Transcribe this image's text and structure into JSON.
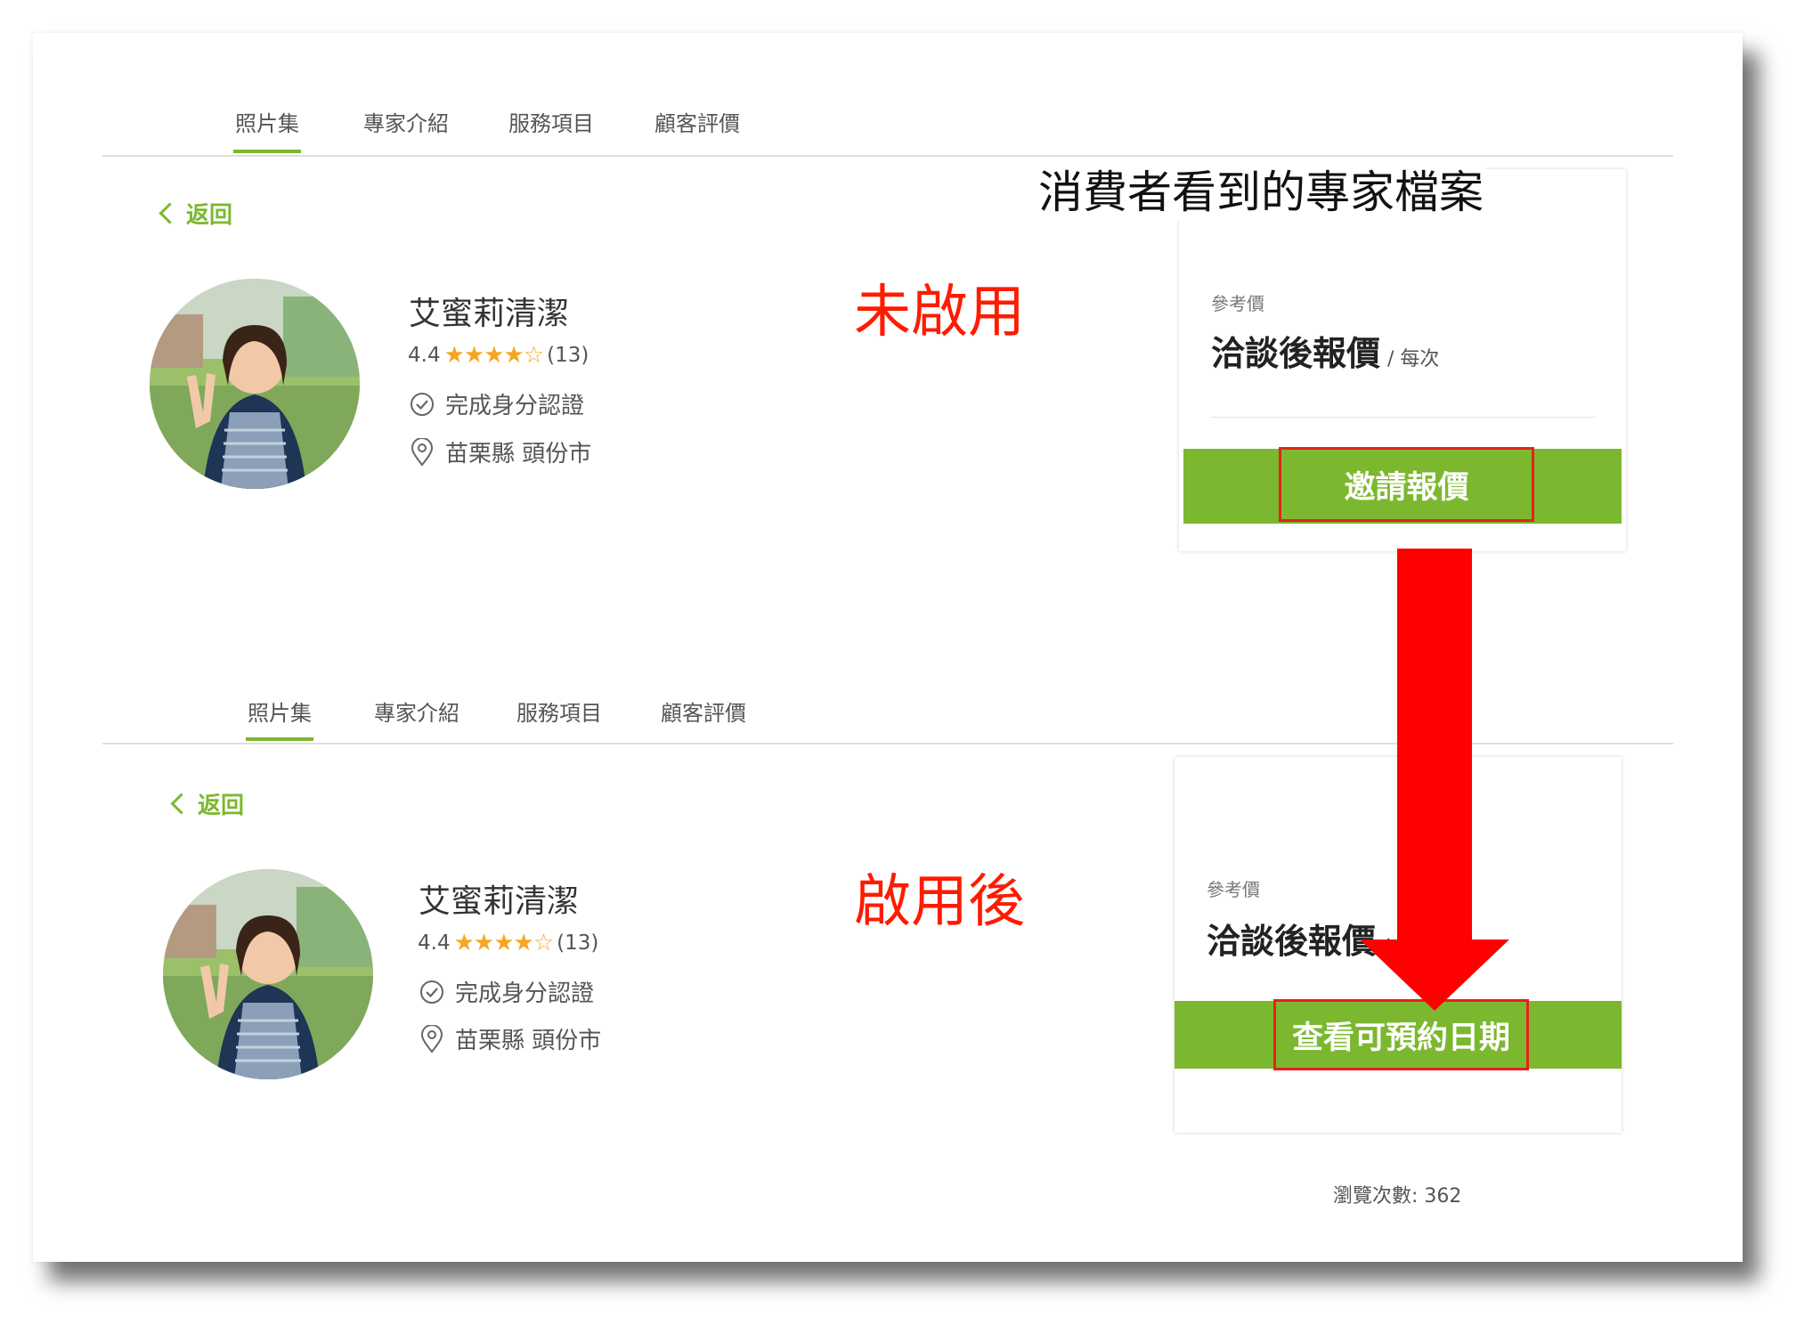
{
  "caption": "消費者看到的專家檔案",
  "tabs": [
    "照片集",
    "專家介紹",
    "服務項目",
    "顧客評價"
  ],
  "back_label": "返回",
  "profile": {
    "name": "艾蜜莉清潔",
    "rating": "4.4",
    "stars": "★★★★☆",
    "rating_fraction": 0.88,
    "review_count": "(13)",
    "verified_label": "完成身分認證",
    "location": "苗栗縣 頭份市"
  },
  "price": {
    "label": "參考價",
    "value": "洽談後報價",
    "unit": "/ 每次"
  },
  "before": {
    "status": "未啟用",
    "button_label": "邀請報價"
  },
  "after": {
    "status": "啟用後",
    "button_label": "查看可預約日期",
    "views": "瀏覽次數: 362"
  },
  "colors": {
    "accent_green": "#7cb82f",
    "annotation_red": "#ff1a00",
    "star_gold": "#f5a623"
  }
}
